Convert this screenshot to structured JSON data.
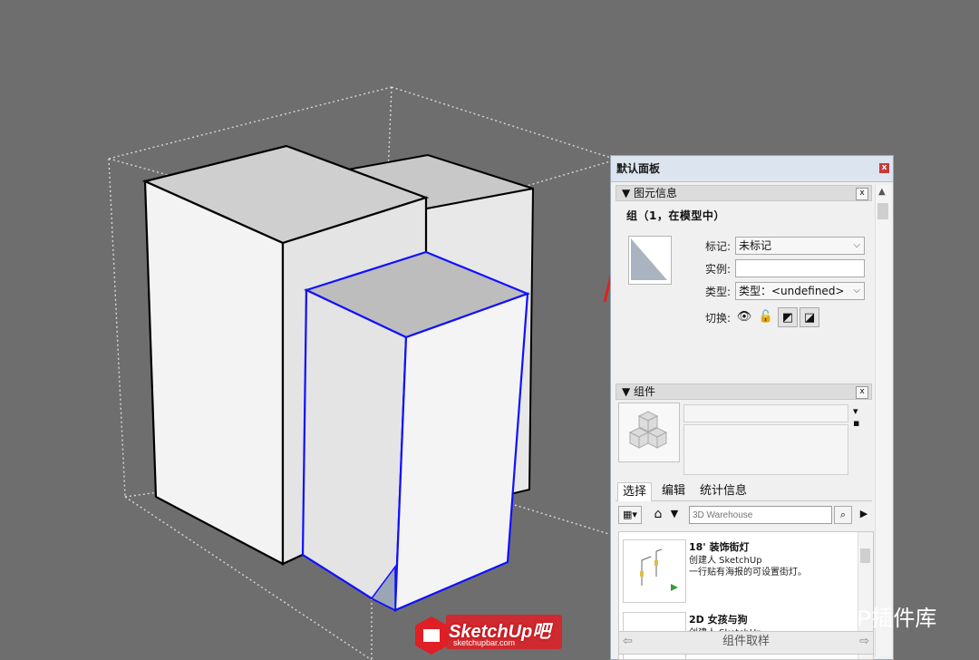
{
  "tray": {
    "title": "默认面板",
    "close_glyph": "x"
  },
  "entity_info": {
    "header": "▼ 图元信息",
    "close_glyph": "x",
    "title": "组（1，在模型中）",
    "tag_label": "标记:",
    "tag_value": "未标记",
    "instance_label": "实例:",
    "instance_value": "",
    "type_label": "类型:",
    "type_value": "类型：<undefined>",
    "toggle_label": "切换:"
  },
  "components": {
    "header": "▼ 组件",
    "close_glyph": "x",
    "tabs": [
      "选择",
      "编辑",
      "统计信息"
    ],
    "search_placeholder": "3D Warehouse",
    "results": [
      {
        "title": "18' 装饰街灯",
        "author": "创建人 SketchUp",
        "desc": "一行贴有海报的可设置街灯。"
      },
      {
        "title": "2D 女孩与狗",
        "author": "创建人 SketchUp",
        "desc": ""
      }
    ],
    "bottom_label": "组件取样"
  },
  "watermarks": {
    "logo": "SketchUp吧",
    "logo_sub": "sketchupbar.com",
    "suapp": "SUAPP插件库"
  },
  "colors": {
    "background": "#6e6e6e",
    "selection": "#0000ff",
    "arrow": "#e02020"
  }
}
